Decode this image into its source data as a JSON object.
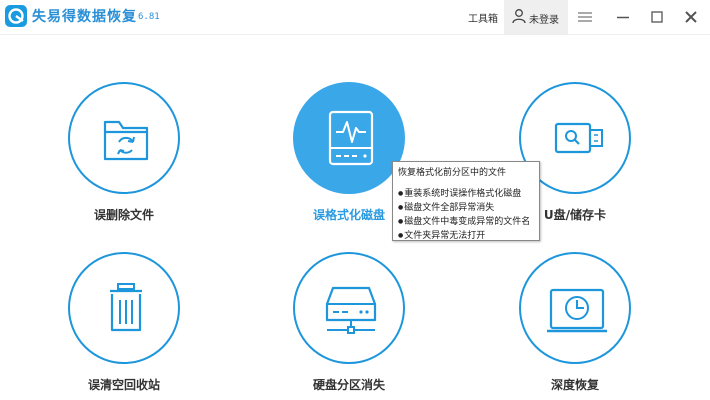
{
  "app": {
    "title": "失易得数据恢复",
    "version": "6.81",
    "accent": "#1e96dc"
  },
  "header": {
    "toolbox_label": "工具箱",
    "login_label": "未登录",
    "menu_icon": "hamburger-icon",
    "minimize_icon": "minimize-icon",
    "maximize_icon": "maximize-icon",
    "close_icon": "close-icon"
  },
  "tiles": [
    {
      "label": "误删除文件",
      "icon": "folder-recycle-icon",
      "active": false
    },
    {
      "label": "误格式化磁盘",
      "icon": "disk-pulse-icon",
      "active": true
    },
    {
      "label": "U盘/储存卡",
      "icon": "usb-drive-icon",
      "active": false
    },
    {
      "label": "误清空回收站",
      "icon": "trash-icon",
      "active": false
    },
    {
      "label": "硬盘分区消失",
      "icon": "hard-drive-icon",
      "active": false
    },
    {
      "label": "深度恢复",
      "icon": "monitor-clock-icon",
      "active": false
    }
  ],
  "tooltip": {
    "title": "恢复格式化前分区中的文件",
    "items": [
      "重装系统时误操作格式化磁盘",
      "磁盘文件全部异常消失",
      "磁盘文件中毒变成异常的文件名",
      "文件夹异常无法打开"
    ]
  }
}
